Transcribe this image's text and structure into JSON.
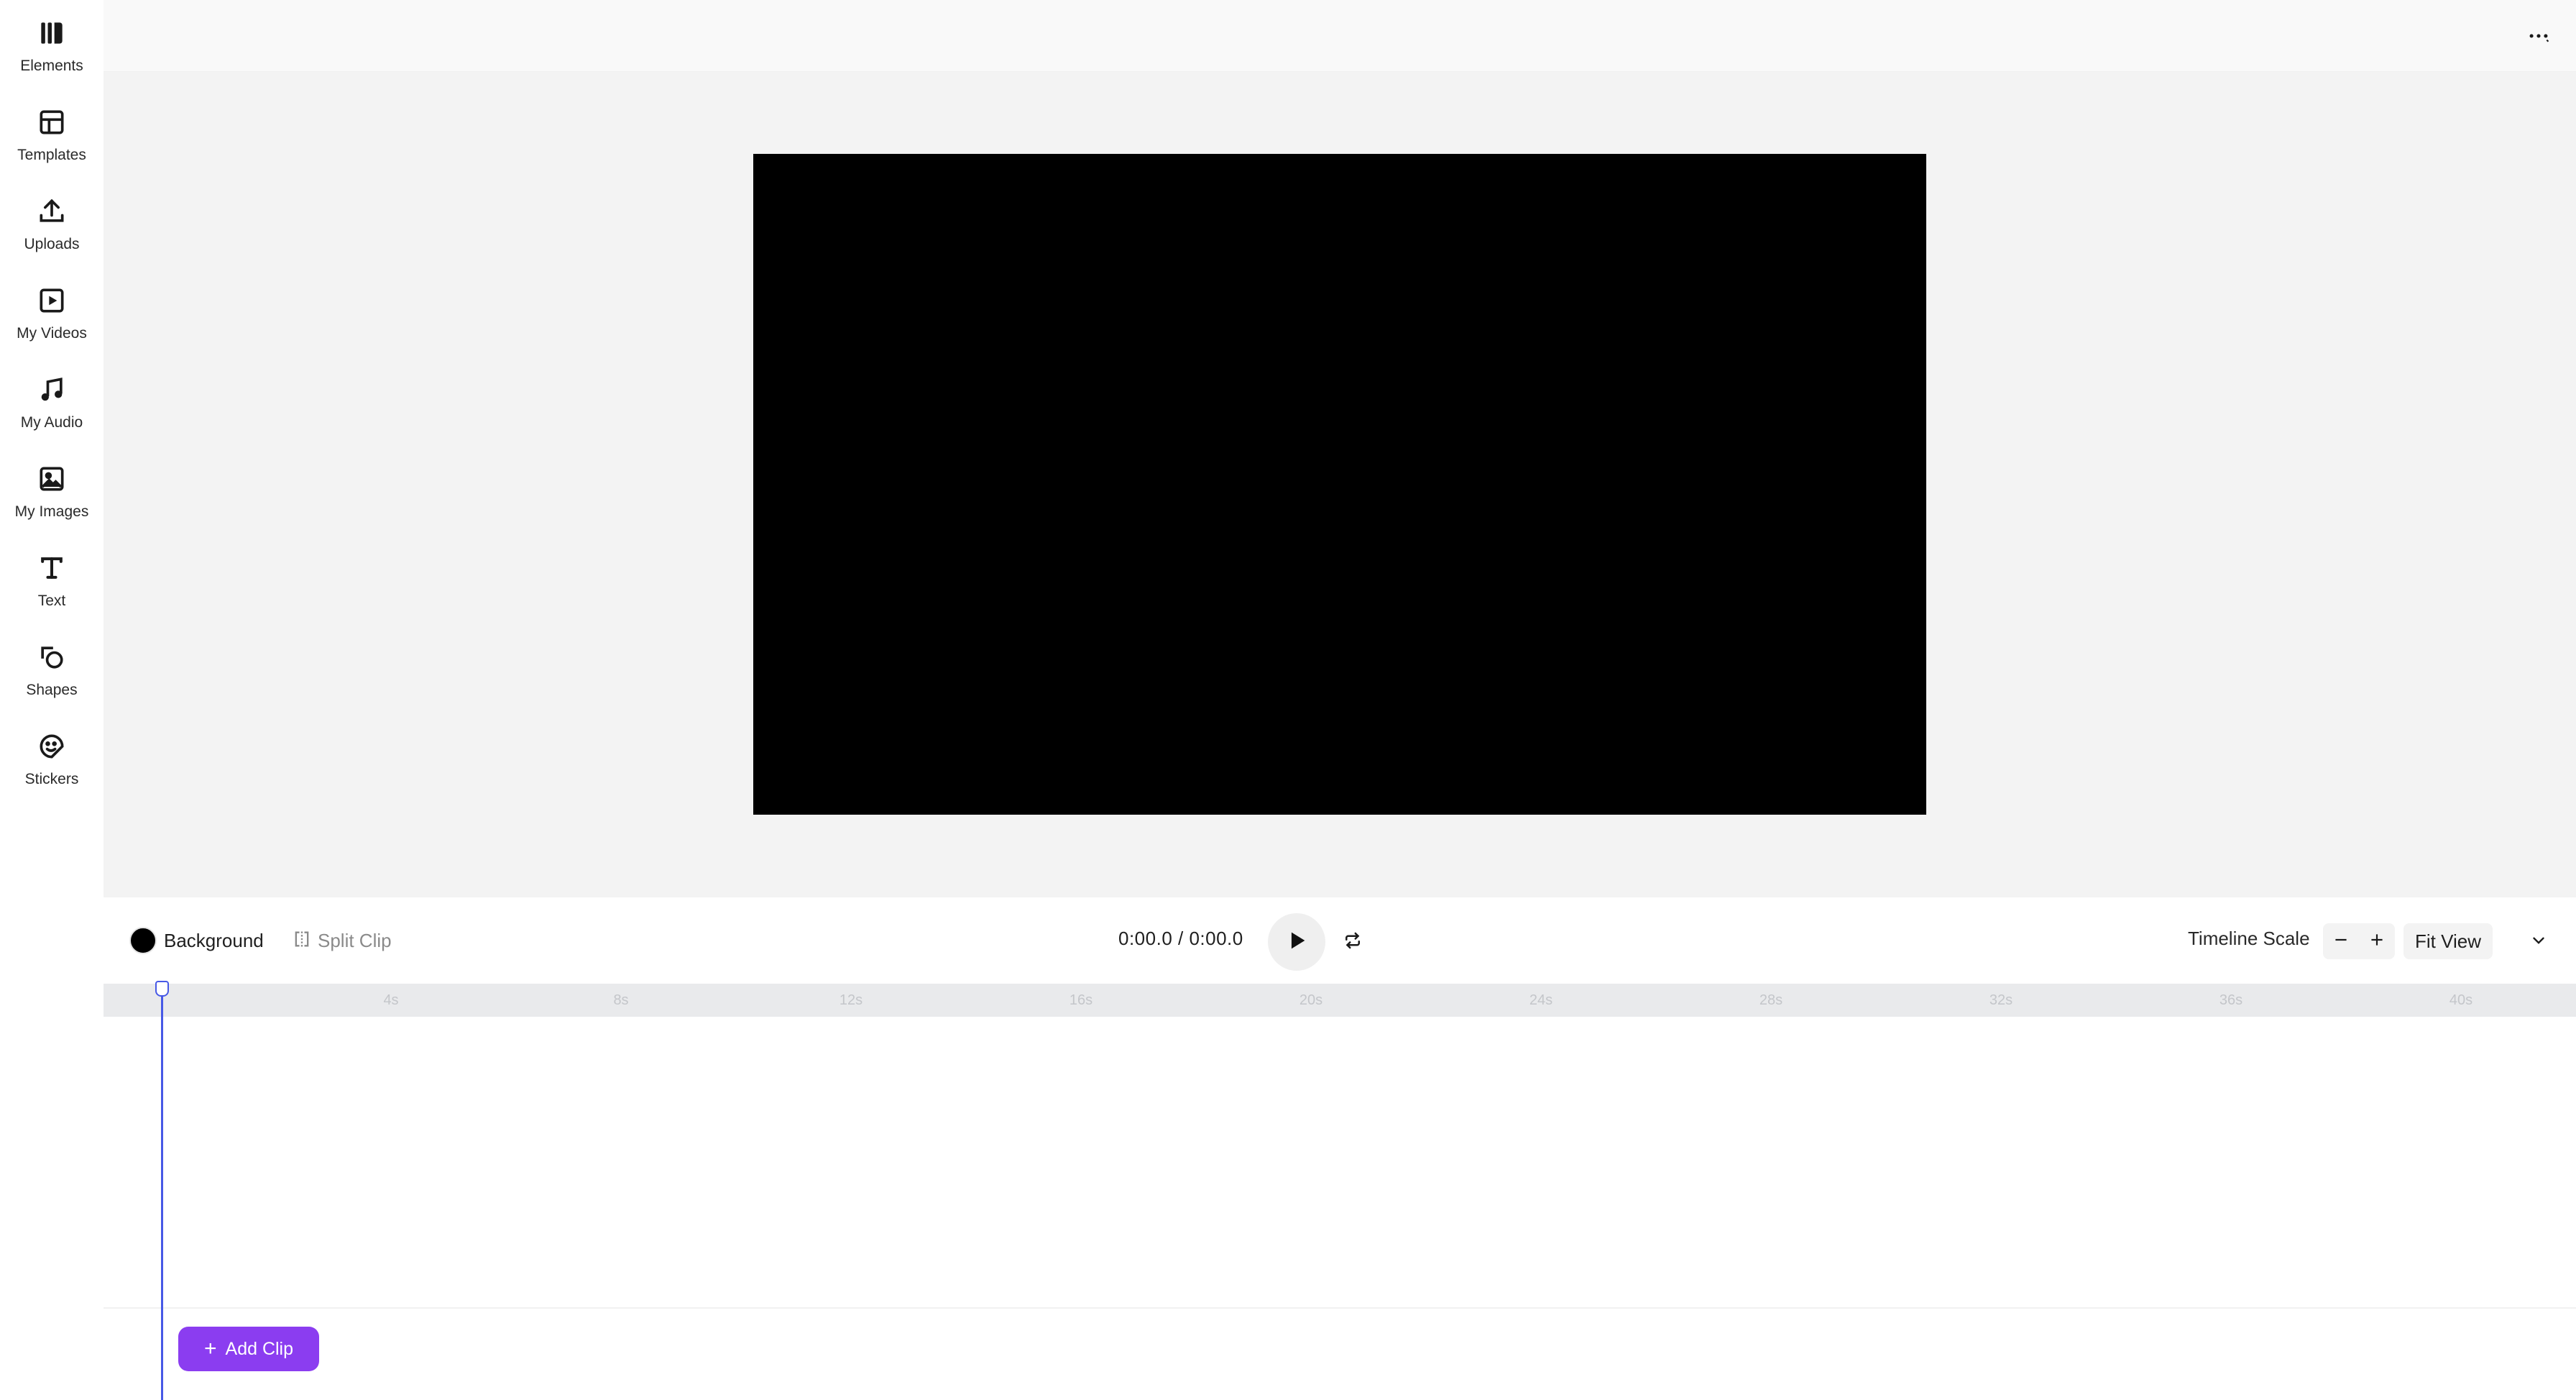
{
  "sidebar": {
    "items": [
      {
        "label": "Elements",
        "icon": "elements-icon"
      },
      {
        "label": "Templates",
        "icon": "templates-icon"
      },
      {
        "label": "Uploads",
        "icon": "upload-icon"
      },
      {
        "label": "My Videos",
        "icon": "video-icon"
      },
      {
        "label": "My Audio",
        "icon": "music-note-icon"
      },
      {
        "label": "My Images",
        "icon": "image-icon"
      },
      {
        "label": "Text",
        "icon": "text-icon"
      },
      {
        "label": "Shapes",
        "icon": "shapes-icon"
      },
      {
        "label": "Stickers",
        "icon": "sticker-icon"
      }
    ]
  },
  "topbar": {
    "more_icon": "more-dots-icon"
  },
  "canvas": {
    "background_color": "#000000"
  },
  "controls": {
    "background_label": "Background",
    "background_color": "#000000",
    "split_label": "Split Clip",
    "time": "0:00.0 / 0:00.0",
    "timeline_scale_label": "Timeline Scale",
    "fit_view_label": "Fit View"
  },
  "timeline": {
    "ticks": [
      "4s",
      "8s",
      "12s",
      "16s",
      "20s",
      "24s",
      "28s",
      "32s",
      "36s",
      "40s"
    ],
    "playhead_seconds": 0
  },
  "add_clip": {
    "label": "Add Clip"
  },
  "colors": {
    "accent": "#8b3df0",
    "playhead": "#4759e6"
  }
}
